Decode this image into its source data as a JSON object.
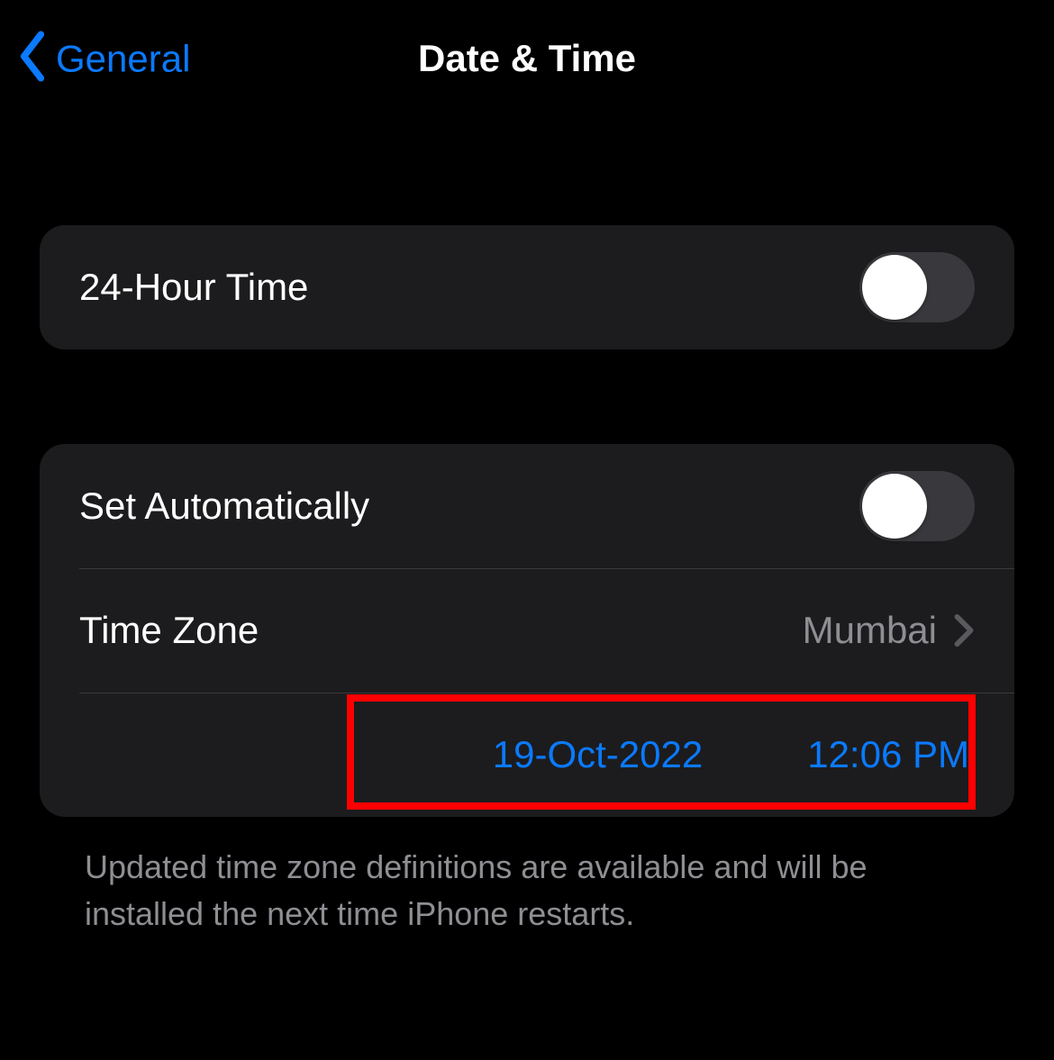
{
  "nav": {
    "back_label": "General",
    "title": "Date & Time"
  },
  "group1": {
    "row1": {
      "label": "24-Hour Time",
      "toggle_on": false
    }
  },
  "group2": {
    "row1": {
      "label": "Set Automatically",
      "toggle_on": false
    },
    "row2": {
      "label": "Time Zone",
      "value": "Mumbai"
    },
    "row3": {
      "date": "19-Oct-2022",
      "time": "12:06 PM"
    }
  },
  "footer": "Updated time zone definitions are available and will be installed the next time iPhone restarts."
}
